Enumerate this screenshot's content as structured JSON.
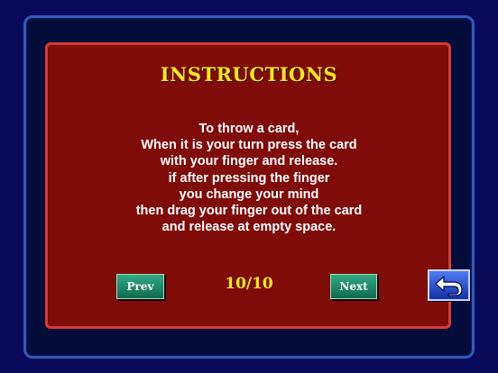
{
  "title": "INSTRUCTIONS",
  "instructions": [
    "To throw a card,",
    "When it is your turn press the card",
    "with your finger and release.",
    "if after pressing the finger",
    "you change your mind",
    "then drag your finger out of the card",
    "and release at empty space."
  ],
  "nav": {
    "prev_label": "Prev",
    "next_label": "Next",
    "page_counter": "10/10",
    "back_icon": "return-arrow-icon"
  },
  "colors": {
    "background": "#0a0a5a",
    "panel": "#7f0c08",
    "panel_border": "#d63c33",
    "title": "#f6ea18",
    "button": "#1f8c68",
    "back_button": "#2d54d8"
  }
}
